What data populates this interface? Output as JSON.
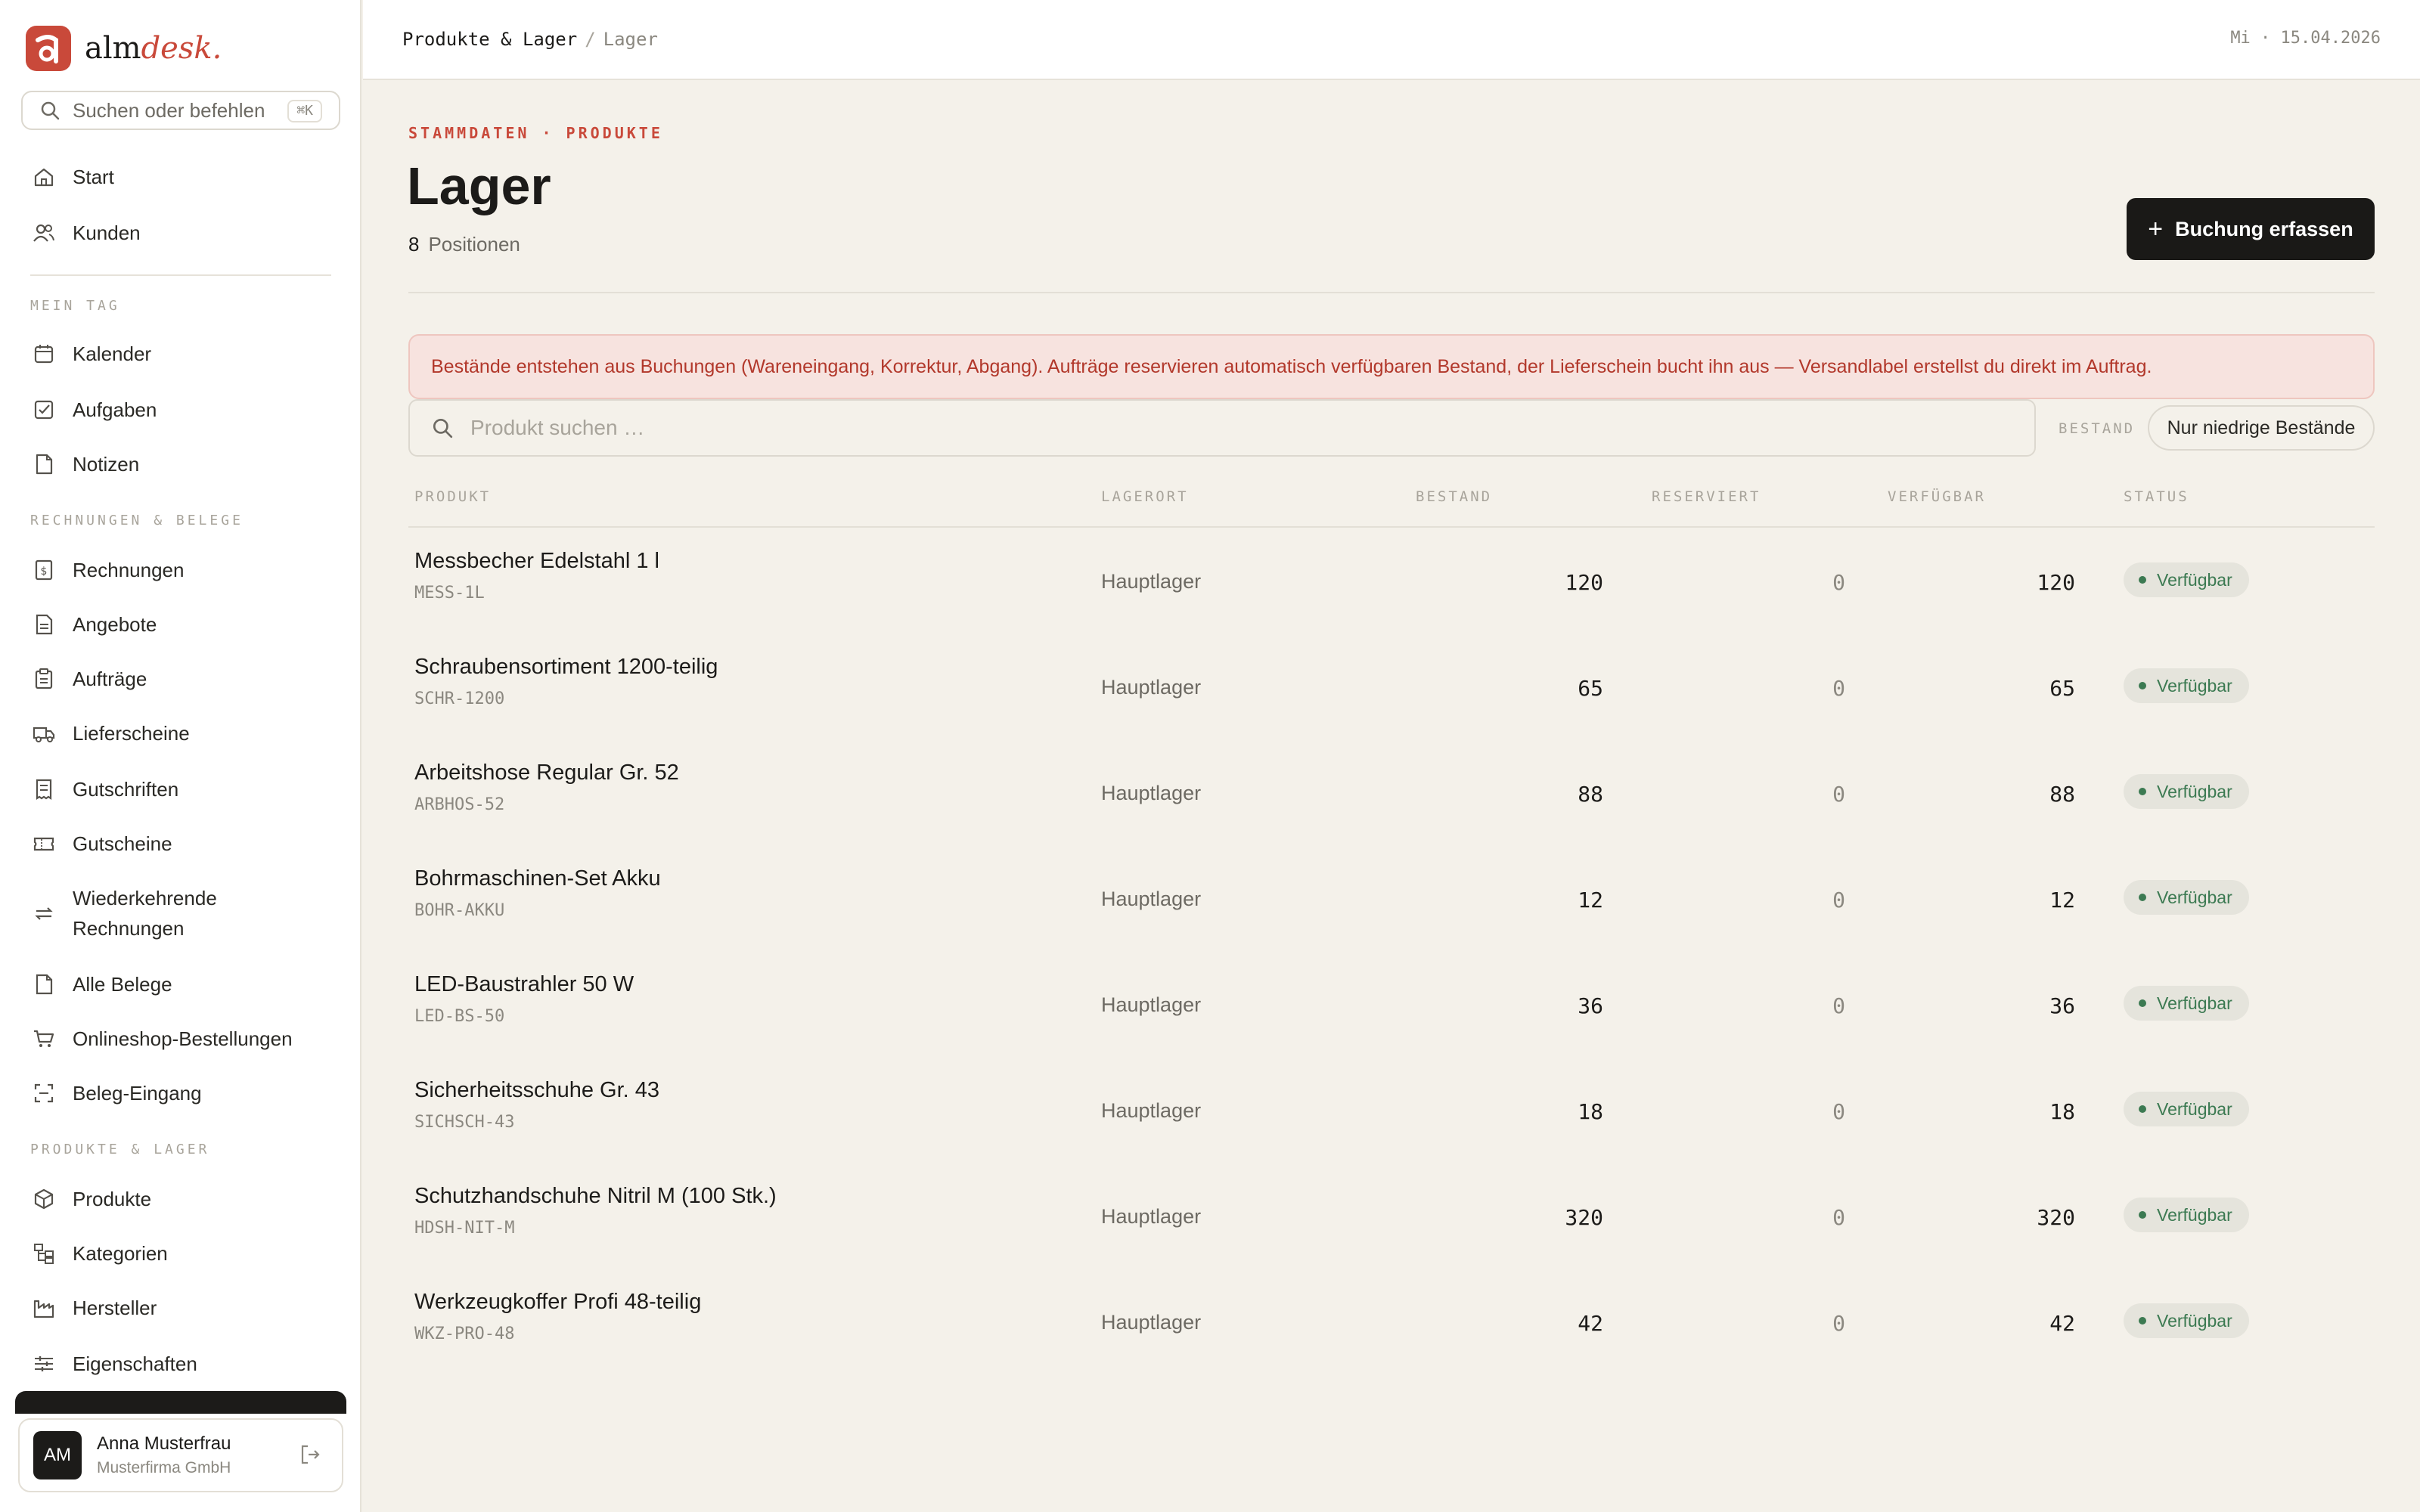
{
  "app": {
    "brand_prefix": "alm",
    "brand_suffix": "desk."
  },
  "sidebar": {
    "search_placeholder": "Suchen oder befehlen",
    "search_shortcut": "⌘K",
    "top_items": [
      {
        "label": "Start",
        "icon": "home-icon"
      },
      {
        "label": "Kunden",
        "icon": "users-icon"
      }
    ],
    "sections": [
      {
        "title": "MEIN TAG",
        "items": [
          {
            "label": "Kalender",
            "icon": "calendar-icon"
          },
          {
            "label": "Aufgaben",
            "icon": "checkbox-icon"
          },
          {
            "label": "Notizen",
            "icon": "note-icon"
          }
        ]
      },
      {
        "title": "RECHNUNGEN & BELEGE",
        "items": [
          {
            "label": "Rechnungen",
            "icon": "invoice-icon"
          },
          {
            "label": "Angebote",
            "icon": "document-icon"
          },
          {
            "label": "Aufträge",
            "icon": "clipboard-icon"
          },
          {
            "label": "Lieferscheine",
            "icon": "truck-icon"
          },
          {
            "label": "Gutschriften",
            "icon": "receipt-icon"
          },
          {
            "label": "Gutscheine",
            "icon": "ticket-icon"
          },
          {
            "label": "Wiederkehrende",
            "label2": "Rechnungen",
            "icon": "repeat-icon"
          },
          {
            "label": "Alle Belege",
            "icon": "files-icon"
          },
          {
            "label": "Onlineshop-Bestellungen",
            "icon": "cart-icon"
          },
          {
            "label": "Beleg-Eingang",
            "icon": "scan-icon"
          }
        ]
      },
      {
        "title": "PRODUKTE & LAGER",
        "items": [
          {
            "label": "Produkte",
            "icon": "box-icon"
          },
          {
            "label": "Kategorien",
            "icon": "tree-icon"
          },
          {
            "label": "Hersteller",
            "icon": "factory-icon"
          },
          {
            "label": "Eigenschaften",
            "icon": "sliders-icon"
          }
        ]
      }
    ],
    "user": {
      "initials": "AM",
      "name": "Anna Musterfrau",
      "company": "Musterfirma GmbH"
    }
  },
  "topbar": {
    "breadcrumb_parent": "Produkte & Lager",
    "breadcrumb_separator": "/",
    "breadcrumb_current": "Lager",
    "date": "Mi · 15.04.2026"
  },
  "main": {
    "eyebrow": "STAMMDATEN · PRODUKTE",
    "title": "Lager",
    "count": "8",
    "count_label": "Positionen",
    "primary_button": "Buchung erfassen",
    "notice": "Bestände entstehen aus Buchungen (Wareneingang, Korrektur, Abgang). Aufträge reservieren automatisch verfügbaren Bestand, der Lieferschein bucht ihn aus — Versandlabel erstellst du direkt im Auftrag.",
    "search_placeholder": "Produkt suchen …",
    "filter_label": "BESTAND",
    "filter_button": "Nur niedrige Bestände"
  },
  "table": {
    "columns": [
      "PRODUKT",
      "LAGERORT",
      "BESTAND",
      "RESERVIERT",
      "VERFÜGBAR",
      "STATUS"
    ],
    "rows": [
      {
        "name": "Messbecher Edelstahl 1 l",
        "sku": "MESS-1L",
        "location": "Hauptlager",
        "stock": "120",
        "reserved": "0",
        "available": "120",
        "status": "Verfügbar"
      },
      {
        "name": "Schraubensortiment 1200-teilig",
        "sku": "SCHR-1200",
        "location": "Hauptlager",
        "stock": "65",
        "reserved": "0",
        "available": "65",
        "status": "Verfügbar"
      },
      {
        "name": "Arbeitshose Regular Gr. 52",
        "sku": "ARBHOS-52",
        "location": "Hauptlager",
        "stock": "88",
        "reserved": "0",
        "available": "88",
        "status": "Verfügbar"
      },
      {
        "name": "Bohrmaschinen-Set Akku",
        "sku": "BOHR-AKKU",
        "location": "Hauptlager",
        "stock": "12",
        "reserved": "0",
        "available": "12",
        "status": "Verfügbar"
      },
      {
        "name": "LED-Baustrahler 50 W",
        "sku": "LED-BS-50",
        "location": "Hauptlager",
        "stock": "36",
        "reserved": "0",
        "available": "36",
        "status": "Verfügbar"
      },
      {
        "name": "Sicherheitsschuhe Gr. 43",
        "sku": "SICHSCH-43",
        "location": "Hauptlager",
        "stock": "18",
        "reserved": "0",
        "available": "18",
        "status": "Verfügbar"
      },
      {
        "name": "Schutzhandschuhe Nitril M (100 Stk.)",
        "sku": "HDSH-NIT-M",
        "location": "Hauptlager",
        "stock": "320",
        "reserved": "0",
        "available": "320",
        "status": "Verfügbar"
      },
      {
        "name": "Werkzeugkoffer Profi 48-teilig",
        "sku": "WKZ-PRO-48",
        "location": "Hauptlager",
        "stock": "42",
        "reserved": "0",
        "available": "42",
        "status": "Verfügbar"
      }
    ]
  },
  "colors": {
    "accent": "#c9493a",
    "background": "#f4f1ea",
    "status_ok": "#3c7a52",
    "notice_bg": "#f7e3df"
  }
}
